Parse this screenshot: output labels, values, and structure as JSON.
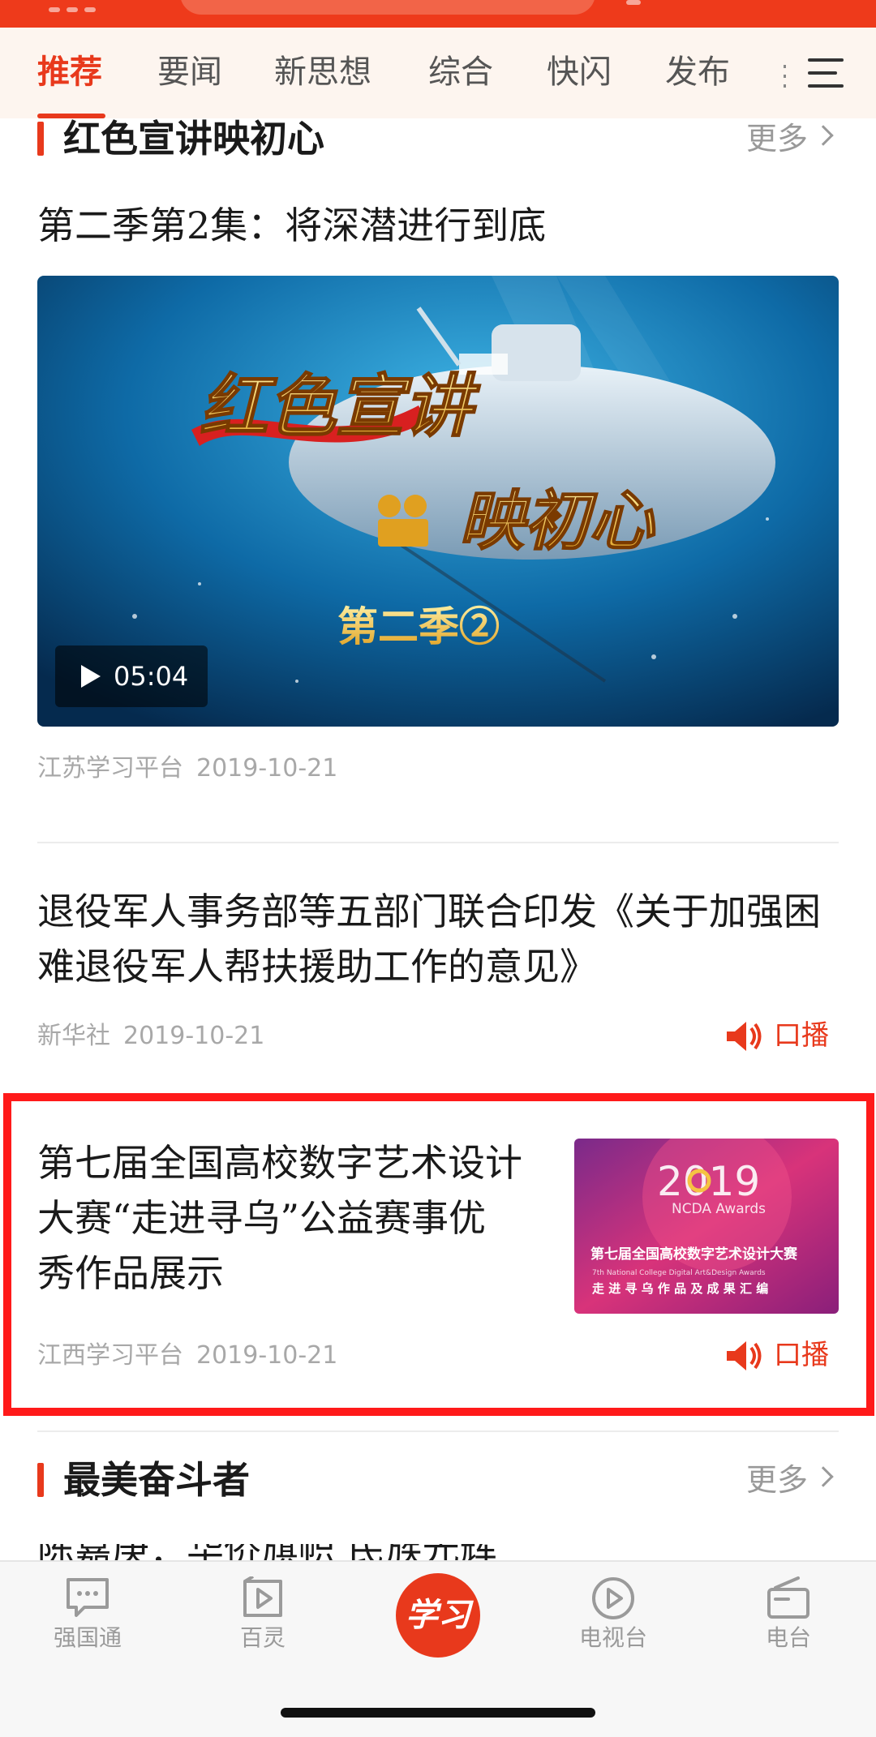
{
  "colors": {
    "accent": "#e8391c",
    "highlight": "#ff1a1a",
    "meta": "#a8a8a8"
  },
  "tabs": [
    {
      "label": "推荐",
      "active": true
    },
    {
      "label": "要闻",
      "active": false
    },
    {
      "label": "新思想",
      "active": false
    },
    {
      "label": "综合",
      "active": false
    },
    {
      "label": "快闪",
      "active": false
    },
    {
      "label": "发布",
      "active": false
    }
  ],
  "menu_icon": "hamburger-menu-icon",
  "section1": {
    "title": "红色宣讲映初心",
    "more": "更多"
  },
  "video_article": {
    "title": "第二季第2集：将深潜进行到底",
    "thumb_text": {
      "line1": "红色宣讲",
      "line2": "映初心",
      "line3": "第二季②"
    },
    "duration": "05:04",
    "source": "江苏学习平台",
    "date": "2019-10-21"
  },
  "article2": {
    "title_line1": "退役军人事务部等五部门联合印发《关于加强困",
    "title_line2": "难退役军人帮扶援助工作的意见》",
    "source": "新华社",
    "date": "2019-10-21",
    "audio_label": "口播"
  },
  "article3": {
    "title_line1": "第七届全国高校数字艺术设计",
    "title_line2": "大赛“走进寻乌”公益赛事优",
    "title_line3": "秀作品展示",
    "source": "江西学习平台",
    "date": "2019-10-21",
    "audio_label": "口播",
    "thumb": {
      "year": "2019",
      "sub": "NCDA Awards",
      "line1": "第七届全国高校数字艺术设计大赛",
      "line2": "7th National College Digital Art&Design Awards",
      "line3": "走 进 寻 乌 作 品 及 成 果 汇 编"
    }
  },
  "section2": {
    "title": "最美奋斗者",
    "more": "更多"
  },
  "peek_text": "陈嘉庚：华侨旗帜 民族光辉",
  "bottom_nav": [
    {
      "label": "强国通",
      "icon": "chat-bubble-icon"
    },
    {
      "label": "百灵",
      "icon": "play-bookmark-icon"
    },
    {
      "label": "学习",
      "icon": "xuexi-logo-icon"
    },
    {
      "label": "电视台",
      "icon": "play-circle-icon"
    },
    {
      "label": "电台",
      "icon": "radio-icon"
    }
  ]
}
